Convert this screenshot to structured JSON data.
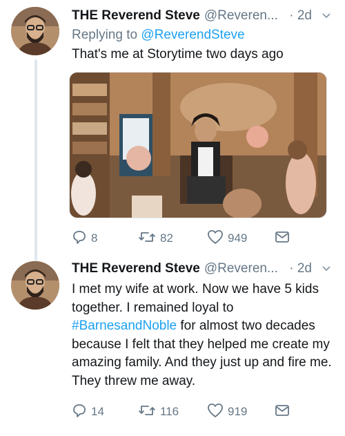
{
  "tweets": [
    {
      "name": "THE Reverend Steve",
      "handle": "@Reveren...",
      "time": "· 2d",
      "reply_prefix": "Replying to ",
      "reply_handle": "@ReverendSteve",
      "text": "That's me at Storytime two days ago",
      "actions": {
        "replies": "8",
        "retweets": "82",
        "likes": "949"
      },
      "icons": [
        "reply-icon",
        "retweet-icon",
        "heart-icon",
        "message-icon"
      ]
    },
    {
      "name": "THE Reverend Steve",
      "handle": "@Reveren...",
      "time": "· 2d",
      "text_before": "I met my wife at work. Now we have 5 kids together. I remained loyal to ",
      "hashtag": "#BarnesandNoble",
      "text_after": " for almost two decades because I felt that they helped me create my amazing family. And they just up and fire me. They threw me away.",
      "actions": {
        "replies": "14",
        "retweets": "116",
        "likes": "919"
      },
      "icons": [
        "reply-icon",
        "retweet-icon",
        "heart-icon",
        "message-icon"
      ]
    }
  ],
  "colors": {
    "link": "#1da1f2",
    "muted": "#657786",
    "divider": "#e1e8ed"
  }
}
